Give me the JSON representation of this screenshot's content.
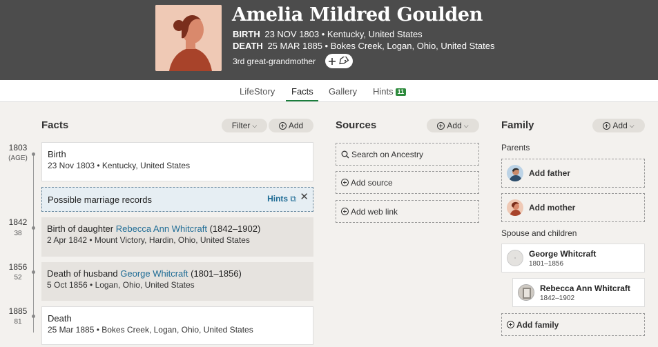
{
  "person": {
    "name": "Amelia Mildred Goulden",
    "birth_label": "BIRTH",
    "birth_value": "23 NOV 1803 • Kentucky, United States",
    "death_label": "DEATH",
    "death_value": "25 MAR 1885 • Bokes Creek, Logan, Ohio, United States",
    "relationship": "3rd great-grandmother"
  },
  "tabs": [
    {
      "label": "LifeStory"
    },
    {
      "label": "Facts"
    },
    {
      "label": "Gallery"
    },
    {
      "label": "Hints",
      "badge": "11"
    }
  ],
  "facts": {
    "title": "Facts",
    "filter_label": "Filter",
    "add_label": "Add",
    "items": [
      {
        "year": "1803",
        "age": "(AGE)",
        "title": "Birth",
        "detail": "23 Nov 1803 • Kentucky, United States"
      },
      {
        "year": "1842",
        "age": "38",
        "title_prefix": "Birth of daughter ",
        "link": "Rebecca Ann Whitcraft",
        "title_suffix": " (1842–1902)",
        "detail": "2 Apr 1842 • Mount Victory, Hardin, Ohio, United States"
      },
      {
        "year": "1856",
        "age": "52",
        "title_prefix": "Death of husband ",
        "link": "George Whitcraft",
        "title_suffix": " (1801–1856)",
        "detail": "5 Oct 1856 • Logan, Ohio, United States"
      },
      {
        "year": "1885",
        "age": "81",
        "title": "Death",
        "detail": "25 Mar 1885 • Bokes Creek, Logan, Ohio, United States"
      }
    ],
    "hint": {
      "text": "Possible marriage records",
      "link": "Hints"
    }
  },
  "sources": {
    "title": "Sources",
    "add_label": "Add",
    "search": "Search on Ancestry",
    "add_source": "Add source",
    "add_web_link": "Add web link"
  },
  "family": {
    "title": "Family",
    "add_label": "Add",
    "parents_label": "Parents",
    "add_father": "Add father",
    "add_mother": "Add mother",
    "spouse_label": "Spouse and children",
    "spouse": {
      "name": "George Whitcraft",
      "years": "1801–1856"
    },
    "child": {
      "name": "Rebecca Ann Whitcraft",
      "years": "1842–1902"
    },
    "add_family": "Add family"
  },
  "colors": {
    "header_bg": "#4c4c4c",
    "accent_green": "#1b7d3c",
    "link_blue": "#1f6c95"
  }
}
